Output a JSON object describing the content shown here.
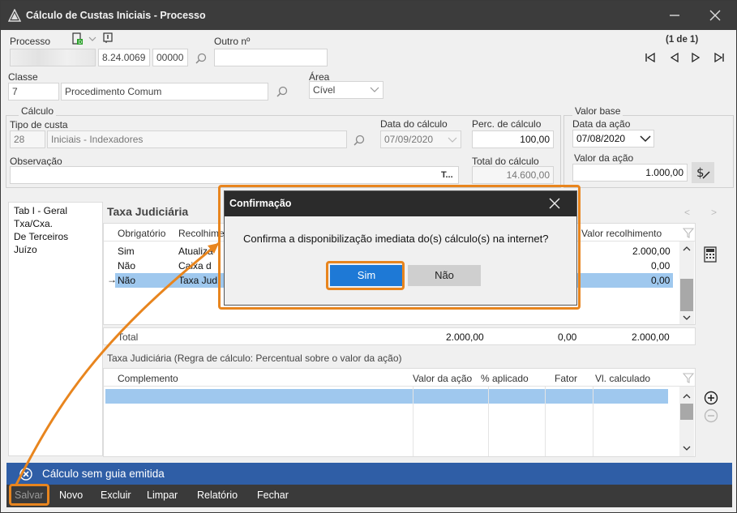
{
  "window": {
    "title": "Cálculo de Custas Iniciais - Processo"
  },
  "processo": {
    "label": "Processo",
    "number_part1": "",
    "number_part2": "8.24.0069",
    "number_part3": "00000",
    "outro_label": "Outro nº",
    "outro_value": ""
  },
  "pagination": {
    "text": "(1 de 1)"
  },
  "classe": {
    "label": "Classe",
    "code": "7",
    "name": "Procedimento Comum"
  },
  "area": {
    "label": "Área",
    "value": "Cível"
  },
  "calculo": {
    "group_label": "Cálculo",
    "tipo_label": "Tipo de custa",
    "tipo_code": "28",
    "tipo_name": "Iniciais - Indexadores",
    "data_label": "Data do cálculo",
    "data_value": "07/09/2020",
    "perc_label": "Perc. de cálculo",
    "perc_value": "100,00",
    "obs_label": "Observação",
    "obs_value": "",
    "obs_button": "T...",
    "total_label": "Total do cálculo",
    "total_value": "14.600,00"
  },
  "valor_base": {
    "group_label": "Valor base",
    "data_acao_label": "Data da ação",
    "data_acao_value": "07/08/2020",
    "valor_acao_label": "Valor da ação",
    "valor_acao_value": "1.000,00"
  },
  "left_list": {
    "items": [
      "Tab I - Geral",
      "Txa/Cxa.",
      "De Terceiros",
      "Juízo"
    ]
  },
  "taxa": {
    "title": "Taxa Judiciária",
    "nav_prev": "<",
    "nav_next": ">",
    "columns": [
      "Obrigatório",
      "Recolhimento",
      "Valor recolhimento"
    ],
    "rows": [
      {
        "obrigatorio": "Sim",
        "recolhimento": "Atualiza",
        "valor": "2.000,00"
      },
      {
        "obrigatorio": "Não",
        "recolhimento": "Caixa d",
        "valor": "0,00"
      },
      {
        "obrigatorio": "Não",
        "recolhimento": "Taxa Jud",
        "valor": "0,00"
      }
    ],
    "total_label": "Total",
    "total_1": "2.000,00",
    "total_2": "0,00",
    "total_3": "2.000,00"
  },
  "regra": {
    "caption": "Taxa Judiciária (Regra de cálculo: Percentual sobre o valor da ação)",
    "columns": [
      "Complemento",
      "Valor da ação",
      "% aplicado",
      "Fator",
      "Vl. calculado"
    ]
  },
  "status": {
    "text": "Cálculo sem guia emitida"
  },
  "toolbar": {
    "salvar": "Salvar",
    "novo": "Novo",
    "excluir": "Excluir",
    "limpar": "Limpar",
    "relatorio": "Relatório",
    "fechar": "Fechar"
  },
  "dialog": {
    "title": "Confirmação",
    "message": "Confirma a disponibilização imediata do(s) cálculo(s) na internet?",
    "yes": "Sim",
    "no": "Não"
  },
  "colors": {
    "accent": "#1e79d6",
    "status_bar": "#2f5ea6",
    "highlight": "#e8851e",
    "selection": "#9fc8ee"
  }
}
